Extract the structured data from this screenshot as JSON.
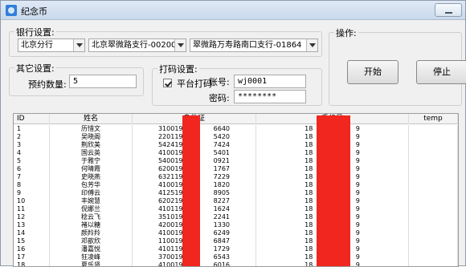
{
  "window": {
    "title": "纪念币",
    "minimize": "minimize"
  },
  "bank": {
    "legend": "银行设置:",
    "branch": "北京分行",
    "subbranch": "北京翠微路支行-00200",
    "outlet": "翠微路万寿路南口支行-01864"
  },
  "other": {
    "legend": "其它设置:",
    "quantity_label": "预约数量:",
    "quantity_value": "5"
  },
  "captcha": {
    "legend": "打码设置:",
    "platform_label": "平台打码",
    "account_label": "账号:",
    "account_value": "wj0001",
    "password_label": "密码:",
    "password_value": "********"
  },
  "operations": {
    "legend": "操作:",
    "start": "开始",
    "stop": "停止"
  },
  "table": {
    "headers": [
      "ID",
      "姓名",
      "身份证",
      "手机号",
      "temp"
    ],
    "rows": [
      {
        "id": "1",
        "name": "历惜文",
        "idcard": "310019519         6640",
        "phone": "18                     9"
      },
      {
        "id": "2",
        "name": "吴晓阁",
        "idcard": "220119711         5420",
        "phone": "18                     9"
      },
      {
        "id": "3",
        "name": "荆欣美",
        "idcard": "542419781         7424",
        "phone": "18                     9"
      },
      {
        "id": "4",
        "name": "国云英",
        "idcard": "410019551         5401",
        "phone": "18                     9"
      },
      {
        "id": "5",
        "name": "于雅宁",
        "idcard": "540019911         0921",
        "phone": "18                     9"
      },
      {
        "id": "6",
        "name": "何晴霞",
        "idcard": "620019181         1767",
        "phone": "18                     9"
      },
      {
        "id": "7",
        "name": "史晓燕",
        "idcard": "632119661         7229",
        "phone": "18                     9"
      },
      {
        "id": "8",
        "name": "包芳华",
        "idcard": "410019701         1820",
        "phone": "18                     9"
      },
      {
        "id": "9",
        "name": "印傅云",
        "idcard": "412519691         8905",
        "phone": "18                     9"
      },
      {
        "id": "10",
        "name": "丰婉慧",
        "idcard": "620219821         8227",
        "phone": "18                     9"
      },
      {
        "id": "11",
        "name": "倪娜兰",
        "idcard": "410119721         1624",
        "phone": "18                     9"
      },
      {
        "id": "12",
        "name": "稔云飞",
        "idcard": "351019781         2241",
        "phone": "18                     9"
      },
      {
        "id": "13",
        "name": "褚以糖",
        "idcard": "420019811         1330",
        "phone": "18                     9"
      },
      {
        "id": "14",
        "name": "颜羚羚",
        "idcard": "410019841         6249",
        "phone": "18                     9"
      },
      {
        "id": "15",
        "name": "邓歆欣",
        "idcard": "110019791         6847",
        "phone": "18                     9"
      },
      {
        "id": "16",
        "name": "潘嘉悦",
        "idcard": "410119831         1729",
        "phone": "18                     9"
      },
      {
        "id": "17",
        "name": "狂凌峰",
        "idcard": "370019831         6543",
        "phone": "18                     9"
      },
      {
        "id": "18",
        "name": "夏乐贤",
        "idcard": "410019701         6016",
        "phone": "18                     9"
      }
    ]
  },
  "colors": {
    "redaction": "#f0261f",
    "window_border": "#8e9aab"
  }
}
